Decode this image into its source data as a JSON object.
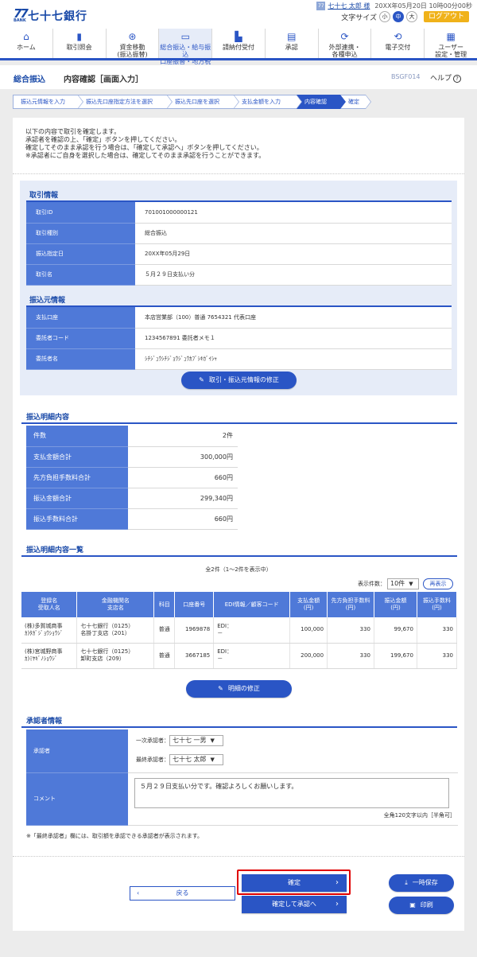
{
  "header": {
    "logo_mark": "77",
    "logo_bank": "BANK",
    "bank_name": "七十七銀行",
    "user_name": "七十七 太郎 様",
    "last_login": "20XX年05月20日 10時00分00秒",
    "font_size_label": "文字サイズ",
    "font_small": "小",
    "font_medium": "中",
    "font_large": "大",
    "logout": "ログアウト"
  },
  "nav": [
    {
      "icon": "home-icon",
      "line1": "ホーム",
      "line2": ""
    },
    {
      "icon": "document-icon",
      "line1": "取引照会",
      "line2": ""
    },
    {
      "icon": "yen-icon",
      "line1": "資金移動",
      "line2": "(振込振替)"
    },
    {
      "icon": "card-icon",
      "line1": "総合振込・給与振込",
      "line2": "口座振替・地方税"
    },
    {
      "icon": "receipt-icon",
      "line1": "請納付受付",
      "line2": ""
    },
    {
      "icon": "approve-icon",
      "line1": "承認",
      "line2": ""
    },
    {
      "icon": "link-icon",
      "line1": "外部連携・",
      "line2": "各種申込"
    },
    {
      "icon": "exchange-icon",
      "line1": "電子交付",
      "line2": ""
    },
    {
      "icon": "user-settings-icon",
      "line1": "ユーザー",
      "line2": "設定・管理"
    }
  ],
  "title": {
    "main": "総合振込",
    "sub": "内容確認［画面入力］",
    "code": "BSGF014",
    "help": "ヘルプ"
  },
  "steps": [
    "振込元情報を入力",
    "振込先口座指定方法を選択",
    "振込先口座を選択",
    "支払金額を入力",
    "内容確認",
    "確定"
  ],
  "intro": [
    "以下の内容で取引を確定します。",
    "承認者を確認の上、「確定」ボタンを押してください。",
    "確定してそのまま承認を行う場合は、「確定して承認へ」ボタンを押してください。",
    "※承認者にご自身を選択した場合は、確定してそのまま承認を行うことができます。"
  ],
  "transaction": {
    "heading": "取引情報",
    "rows": [
      {
        "k": "取引ID",
        "v": "701001000000121"
      },
      {
        "k": "取引種別",
        "v": "総合振込"
      },
      {
        "k": "振込指定日",
        "v": "20XX年05月29日"
      },
      {
        "k": "取引名",
        "v": "５月２９日支払い分"
      }
    ]
  },
  "source": {
    "heading": "振込元情報",
    "rows": [
      {
        "k": "支払口座",
        "v": "本店営業部（100）普通 7654321 代表口座"
      },
      {
        "k": "委託者コード",
        "v": "1234567891 委託者メモ１"
      },
      {
        "k": "委託者名",
        "v": "ｼﾁｼﾞｭｳｼﾁｼﾞｮｳｼﾞｭｳｶﾌﾞｼｷｶﾞｲｼｬ"
      }
    ],
    "edit_button": "取引・振込元情報の修正"
  },
  "summary": {
    "heading": "振込明細内容",
    "rows": [
      {
        "k": "件数",
        "v": "2件"
      },
      {
        "k": "支払金額合計",
        "v": "300,000円"
      },
      {
        "k": "先方負担手数料合計",
        "v": "660円"
      },
      {
        "k": "振込金額合計",
        "v": "299,340円"
      },
      {
        "k": "振込手数料合計",
        "v": "660円"
      }
    ]
  },
  "list": {
    "heading": "振込明細内容一覧",
    "count_text": "全2件（1～2件を表示中）",
    "page_size_label": "表示件数：",
    "page_size": "10件",
    "redisplay": "再表示",
    "headers": [
      [
        "登録名",
        "受取人名"
      ],
      [
        "金融機関名",
        "支店名"
      ],
      [
        "科目",
        ""
      ],
      [
        "口座番号",
        ""
      ],
      [
        "EDI情報／顧客コード",
        ""
      ],
      [
        "支払金額",
        "(円)"
      ],
      [
        "先方負担手数料",
        "(円)"
      ],
      [
        "振込金額",
        "(円)"
      ],
      [
        "振込手数料",
        "(円)"
      ]
    ],
    "rows": [
      {
        "name1": "(株)多賀城商事",
        "name2": "ｶ)ﾀｶﾞｼﾞｮｳｼｮｳｼﾞ",
        "bank1": "七十七銀行（0125）",
        "bank2": "名掛丁支店（201）",
        "type": "普通",
        "account": "1969878",
        "edi1": "EDI：",
        "edi2": "－",
        "pay": "100,000",
        "fee_payee": "330",
        "transfer": "99,670",
        "fee": "330"
      },
      {
        "name1": "(株)宮城野商事",
        "name2": "ｶ)ﾐﾔｷﾞﾉｼｮｳｼﾞ",
        "bank1": "七十七銀行（0125）",
        "bank2": "卸町支店（209）",
        "type": "普通",
        "account": "3667185",
        "edi1": "EDI：",
        "edi2": "－",
        "pay": "200,000",
        "fee_payee": "330",
        "transfer": "199,670",
        "fee": "330"
      }
    ],
    "edit_button": "明細の修正"
  },
  "approver": {
    "heading": "承認者情報",
    "label": "承認者",
    "first_label": "一次承認者：",
    "first_value": "七十七 一男",
    "final_label": "最終承認者：",
    "final_value": "七十七 太郎",
    "comment_label": "コメント",
    "comment": "５月２９日支払い分です。確認よろしくお願いします。",
    "limit_note": "全角120文字以内［半角可］",
    "footnote": "※「最終承認者」欄には、取引額を承認できる承認者が表示されます。"
  },
  "actions": {
    "back": "戻る",
    "confirm": "確定",
    "confirm_approve": "確定して承認へ",
    "save": "一時保存",
    "print": "印刷"
  },
  "colors": {
    "primary": "#2a55c5",
    "highlight": "#e00000",
    "accent": "#f0b21a"
  }
}
